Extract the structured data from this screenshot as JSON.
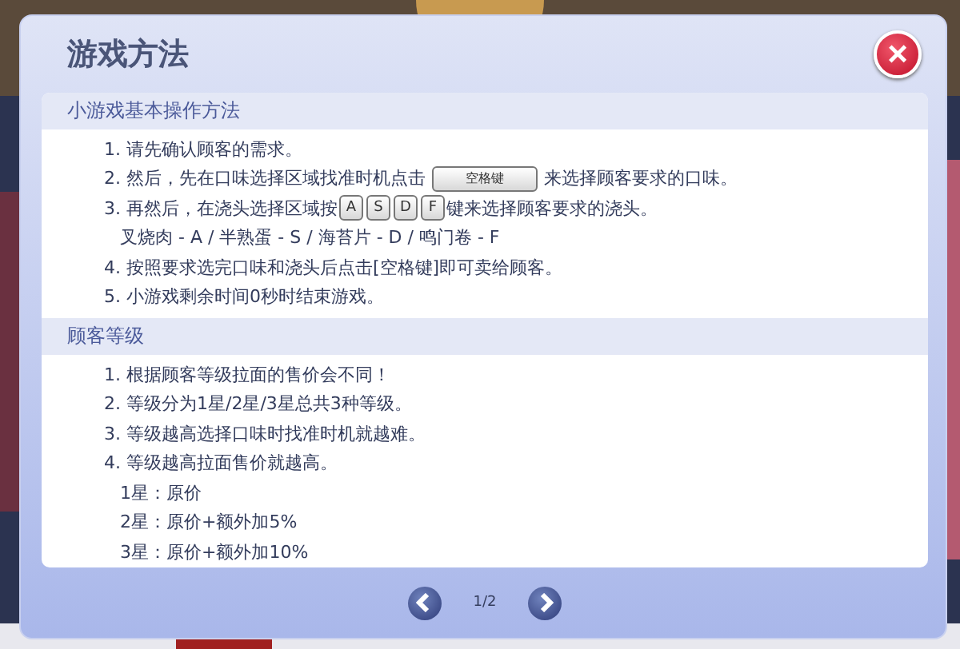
{
  "dialog": {
    "title": "游戏方法",
    "close": "×"
  },
  "sections": [
    {
      "title": "小游戏基本操作方法",
      "items": [
        {
          "parts": [
            {
              "kind": "text",
              "text": "1. 请先确认顾客的需求。"
            }
          ]
        },
        {
          "parts": [
            {
              "kind": "text",
              "text": "2. 然后，先在口味选择区域找准时机点击"
            },
            {
              "kind": "wide-key",
              "text": "空格键"
            },
            {
              "kind": "text",
              "text": "来选择顾客要求的口味。"
            }
          ]
        },
        {
          "parts": [
            {
              "kind": "text",
              "text": "3. 再然后，在浇头选择区域按"
            },
            {
              "kind": "key",
              "text": "A"
            },
            {
              "kind": "key",
              "text": "S"
            },
            {
              "kind": "key",
              "text": "D"
            },
            {
              "kind": "key",
              "text": "F"
            },
            {
              "kind": "text",
              "text": "键来选择顾客要求的浇头。"
            }
          ],
          "children": [
            {
              "parts": [
                {
                  "kind": "text",
                  "text": "叉烧肉 - A / 半熟蛋 - S / 海苔片 - D / 鸣门卷 - F"
                }
              ]
            }
          ]
        },
        {
          "parts": [
            {
              "kind": "text",
              "text": "4. 按照要求选完口味和浇头后点击[空格键]即可卖给顾客。"
            }
          ]
        },
        {
          "parts": [
            {
              "kind": "text",
              "text": "5. 小游戏剩余时间0秒时结束游戏。"
            }
          ]
        }
      ]
    },
    {
      "title": "顾客等级",
      "items": [
        {
          "parts": [
            {
              "kind": "text",
              "text": "1. 根据顾客等级拉面的售价会不同！"
            }
          ]
        },
        {
          "parts": [
            {
              "kind": "text",
              "text": "2. 等级分为1星/2星/3星总共3种等级。"
            }
          ]
        },
        {
          "parts": [
            {
              "kind": "text",
              "text": "3. 等级越高选择口味时找准时机就越难。"
            }
          ]
        },
        {
          "parts": [
            {
              "kind": "text",
              "text": "4. 等级越高拉面售价就越高。"
            }
          ],
          "children": [
            {
              "parts": [
                {
                  "kind": "text",
                  "text": "1星：原价"
                }
              ]
            },
            {
              "parts": [
                {
                  "kind": "text",
                  "text": "2星：原价+额外加5%"
                }
              ]
            },
            {
              "parts": [
                {
                  "kind": "text",
                  "text": "3星：原价+额外加10%"
                }
              ]
            }
          ]
        }
      ]
    }
  ],
  "pager": {
    "page": "1/2"
  }
}
